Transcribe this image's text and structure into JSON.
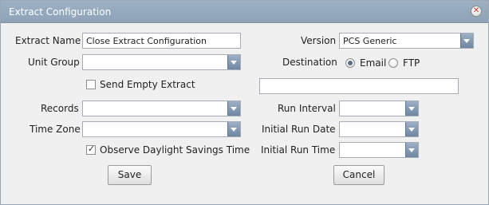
{
  "dialog": {
    "title": "Extract Configuration",
    "close_icon": "close-icon"
  },
  "form": {
    "extract_name_label": "Extract Name",
    "extract_name_value": "Close Extract Configuration",
    "unit_group_label": "Unit Group",
    "unit_group_value": "",
    "send_empty_extract_label": "Send Empty Extract",
    "send_empty_extract_checked": false,
    "records_label": "Records",
    "records_value": "",
    "time_zone_label": "Time Zone",
    "time_zone_value": "",
    "observe_dst_label": "Observe Daylight Savings Time",
    "observe_dst_checked": true,
    "version_label": "Version",
    "version_value": "PCS Generic",
    "destination_label": "Destination",
    "destination_email_label": "Email",
    "destination_ftp_label": "FTP",
    "destination_selected": "Email",
    "destination_address_value": "",
    "run_interval_label": "Run Interval",
    "run_interval_value": "",
    "initial_run_date_label": "Initial Run Date",
    "initial_run_date_value": "",
    "initial_run_time_label": "Initial Run Time",
    "initial_run_time_value": ""
  },
  "buttons": {
    "save_label": "Save",
    "cancel_label": "Cancel"
  },
  "colors": {
    "titlebar": "#9db0c4",
    "dialog_background": "#f0f0f0",
    "dropdown_button": "#6f86a2"
  }
}
